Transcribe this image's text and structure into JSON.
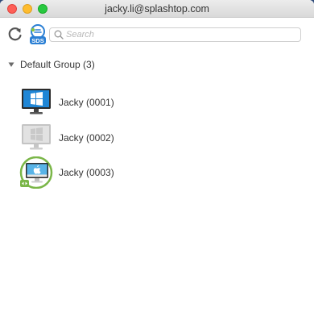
{
  "window": {
    "title": "jacky.li@splashtop.com"
  },
  "toolbar": {
    "refresh_icon": "refresh-icon",
    "sds_icon": "sds-icon",
    "sds_label": "SDS",
    "search": {
      "placeholder": "Search",
      "value": ""
    }
  },
  "group": {
    "label": "Default Group (3)",
    "expanded": true
  },
  "devices": [
    {
      "name": "Jacky (0001)",
      "os": "windows",
      "status": "online"
    },
    {
      "name": "Jacky (0002)",
      "os": "windows",
      "status": "offline"
    },
    {
      "name": "Jacky (0003)",
      "os": "mac",
      "status": "connected"
    }
  ],
  "colors": {
    "online_screen": "#1f86d6",
    "offline_screen": "#d8d8d8",
    "connected_ring": "#7ab648",
    "sds_badge": "#2a7fd4"
  }
}
